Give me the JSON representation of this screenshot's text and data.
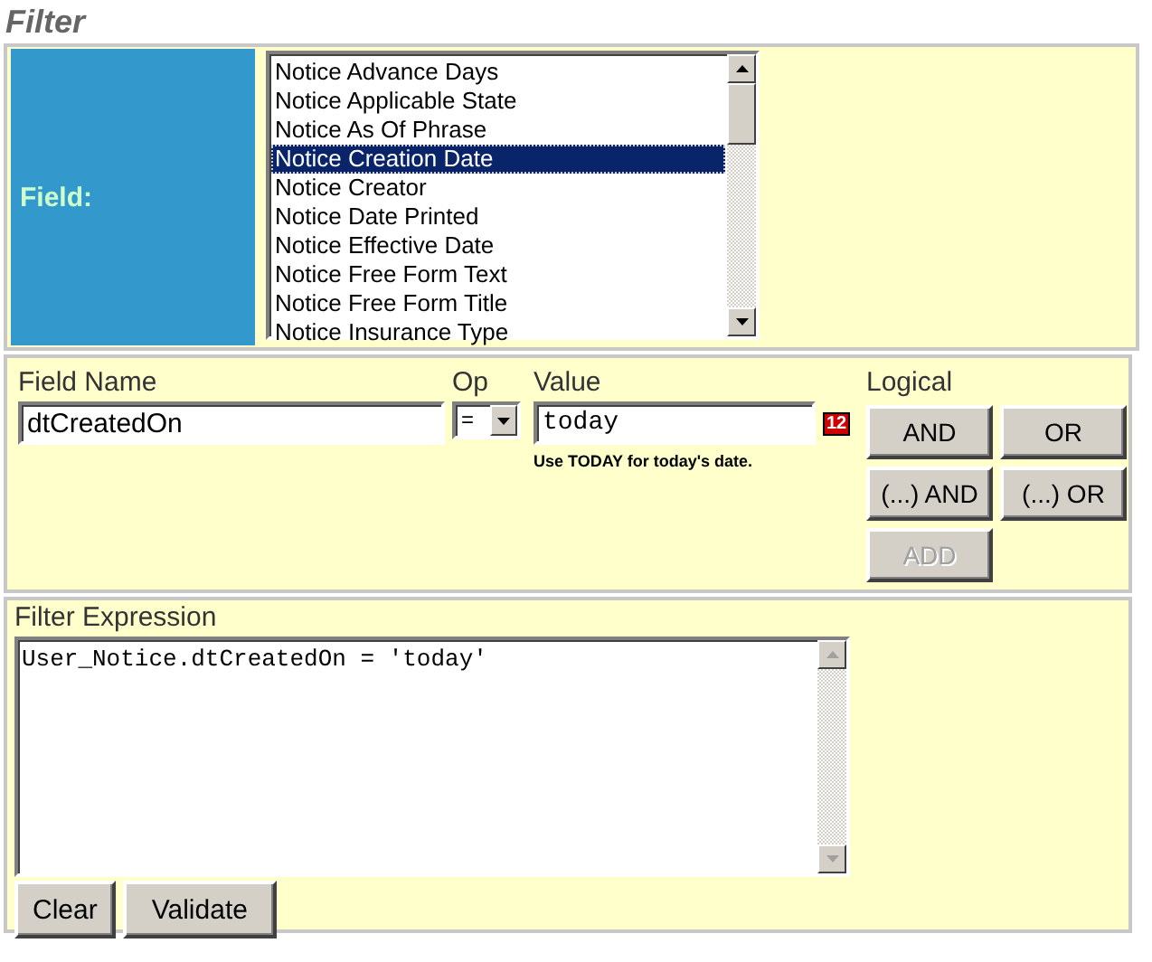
{
  "title": "Filter",
  "field_section": {
    "label": "Field:",
    "options": [
      {
        "label": "Notice Advance Days",
        "selected": false
      },
      {
        "label": "Notice Applicable State",
        "selected": false
      },
      {
        "label": "Notice As Of Phrase",
        "selected": false
      },
      {
        "label": "Notice Creation Date",
        "selected": true
      },
      {
        "label": "Notice Creator",
        "selected": false
      },
      {
        "label": "Notice Date Printed",
        "selected": false
      },
      {
        "label": "Notice Effective Date",
        "selected": false
      },
      {
        "label": "Notice Free Form Text",
        "selected": false
      },
      {
        "label": "Notice Free Form Title",
        "selected": false
      },
      {
        "label": "Notice Insurance Type",
        "selected": false
      }
    ]
  },
  "condition": {
    "field_name_label": "Field Name",
    "field_name_value": "dtCreatedOn",
    "op_label": "Op",
    "op_value": "=",
    "value_label": "Value",
    "value": "today",
    "calendar_button": "12",
    "hint": "Use TODAY for today's date.",
    "logical_label": "Logical",
    "buttons": [
      {
        "label": "AND",
        "disabled": false
      },
      {
        "label": "OR",
        "disabled": false
      },
      {
        "label": "(...) AND",
        "disabled": false
      },
      {
        "label": "(...) OR",
        "disabled": false
      },
      {
        "label": "ADD",
        "disabled": true
      }
    ]
  },
  "expression": {
    "label": "Filter Expression",
    "value": "User_Notice.dtCreatedOn = 'today'",
    "buttons": [
      "Clear",
      "Validate"
    ]
  }
}
